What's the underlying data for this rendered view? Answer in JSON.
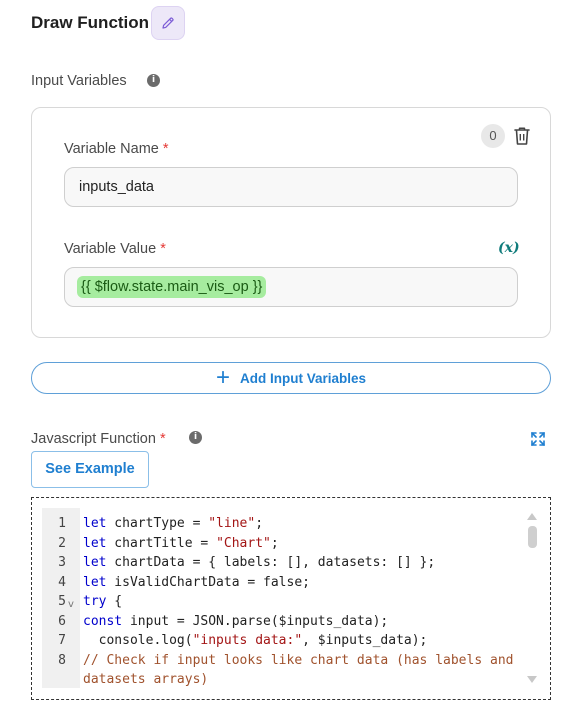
{
  "header": {
    "title": "Draw Function",
    "edit_icon": "pencil-icon"
  },
  "input_variables": {
    "label": "Input Variables",
    "count": "0",
    "variable_name": {
      "label": "Variable Name",
      "required_mark": "*",
      "value": "inputs_data"
    },
    "variable_value": {
      "label": "Variable Value",
      "required_mark": "*",
      "fx_label": "(x)",
      "value": "{{ $flow.state.main_vis_op }}"
    },
    "add_button_label": "Add Input Variables"
  },
  "javascript_function": {
    "label": "Javascript Function",
    "required_mark": "*",
    "see_example_label": "See Example",
    "line_numbers": [
      "1",
      "2",
      "3",
      "4",
      "5",
      "6",
      "7",
      "8"
    ],
    "lines": [
      "let chartType = \"line\";",
      "let chartTitle = \"Chart\";",
      "let chartData = { labels: [], datasets: [] };",
      "let isValidChartData = false;",
      "try {",
      "const input = JSON.parse($inputs_data);",
      "  console.log(\"inputs data:\", $inputs_data);",
      "// Check if input looks like chart data (has labels and",
      "datasets arrays)"
    ]
  },
  "colors": {
    "accent": "#1f7fd0",
    "chip_bg": "#a6ec9f",
    "required": "#e53935",
    "keyword": "#0000cc",
    "string": "#a31515",
    "comment": "#a0522d"
  }
}
